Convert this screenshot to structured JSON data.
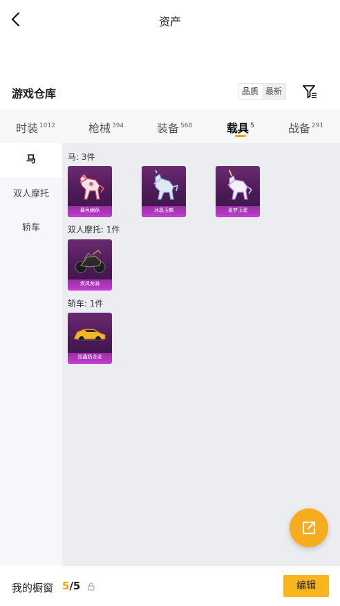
{
  "header": {
    "title": "资产"
  },
  "warehouse": {
    "title": "游戏仓库",
    "sort": [
      "品质",
      "最新"
    ]
  },
  "tabs": [
    {
      "label": "时装",
      "count": "1012"
    },
    {
      "label": "枪械",
      "count": "394"
    },
    {
      "label": "装备",
      "count": "568"
    },
    {
      "label": "载具",
      "count": "5",
      "active": true
    },
    {
      "label": "战备",
      "count": "291"
    }
  ],
  "sidebar": {
    "items": [
      {
        "label": "马"
      },
      {
        "label": "双人摩托"
      },
      {
        "label": "轿车"
      }
    ]
  },
  "groups": [
    {
      "label": "马: 3件",
      "items": [
        {
          "name": "暮色幽蹄"
        },
        {
          "name": "冰晶玉麟"
        },
        {
          "name": "星梦玉骢"
        }
      ]
    },
    {
      "label": "双人摩托: 1件",
      "items": [
        {
          "name": "疾风龙骑"
        }
      ]
    },
    {
      "label": "轿车: 1件",
      "items": [
        {
          "name": "拉鑫奶龙龙"
        }
      ]
    }
  ],
  "footer": {
    "showcase_label": "我的橱窗",
    "count_current": "5",
    "count_total": "/5",
    "edit_label": "编辑"
  },
  "colors": {
    "accent": "#f5a300",
    "card_rarity": "#c63ad6"
  }
}
